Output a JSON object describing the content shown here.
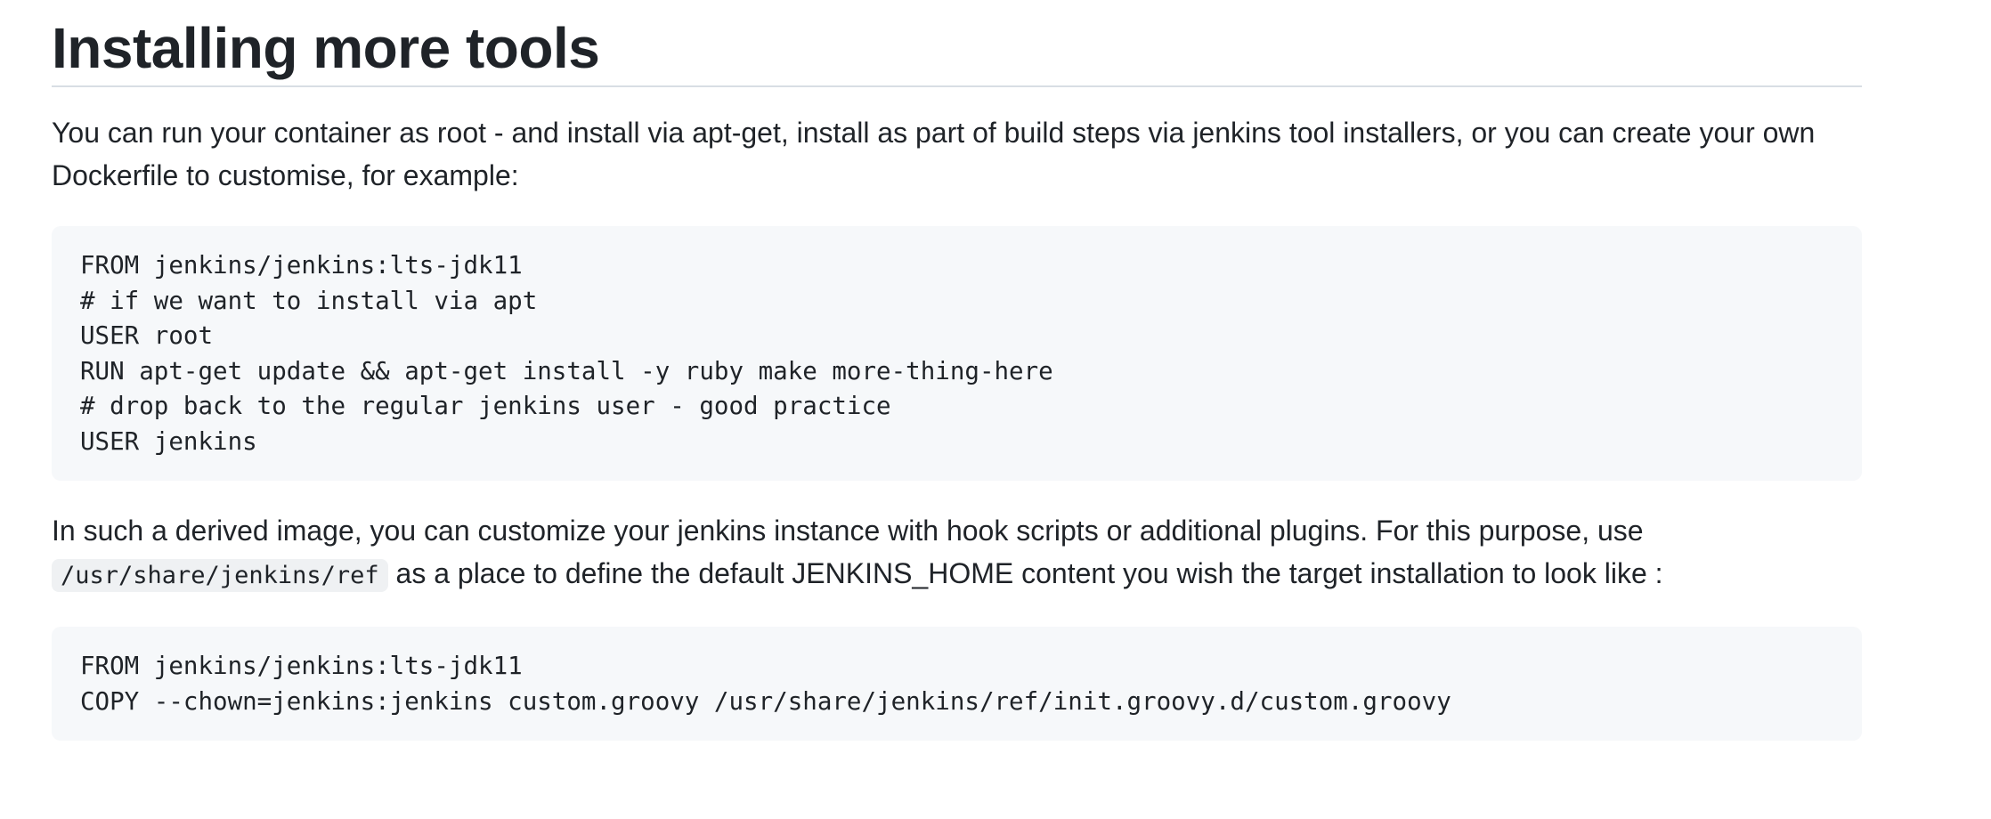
{
  "heading": "Installing more tools",
  "intro_paragraph": "You can run your container as root - and install via apt-get, install as part of build steps via jenkins tool installers, or you can create your own Dockerfile to customise, for example:",
  "code_block_1": {
    "lines": [
      "FROM jenkins/jenkins:lts-jdk11",
      "# if we want to install via apt",
      "USER root",
      "RUN apt-get update && apt-get install -y ruby make more-thing-here",
      "# drop back to the regular jenkins user - good practice",
      "USER jenkins"
    ]
  },
  "derived_paragraph": {
    "text_before": "In such a derived image, you can customize your jenkins instance with hook scripts or additional plugins. For this purpose, use ",
    "inline_code": "/usr/share/jenkins/ref",
    "text_after": " as a place to define the default JENKINS_HOME content you wish the target installation to look like :"
  },
  "code_block_2": {
    "lines": [
      "FROM jenkins/jenkins:lts-jdk11",
      "COPY --chown=jenkins:jenkins custom.groovy /usr/share/jenkins/ref/init.groovy.d/custom.groovy"
    ]
  }
}
